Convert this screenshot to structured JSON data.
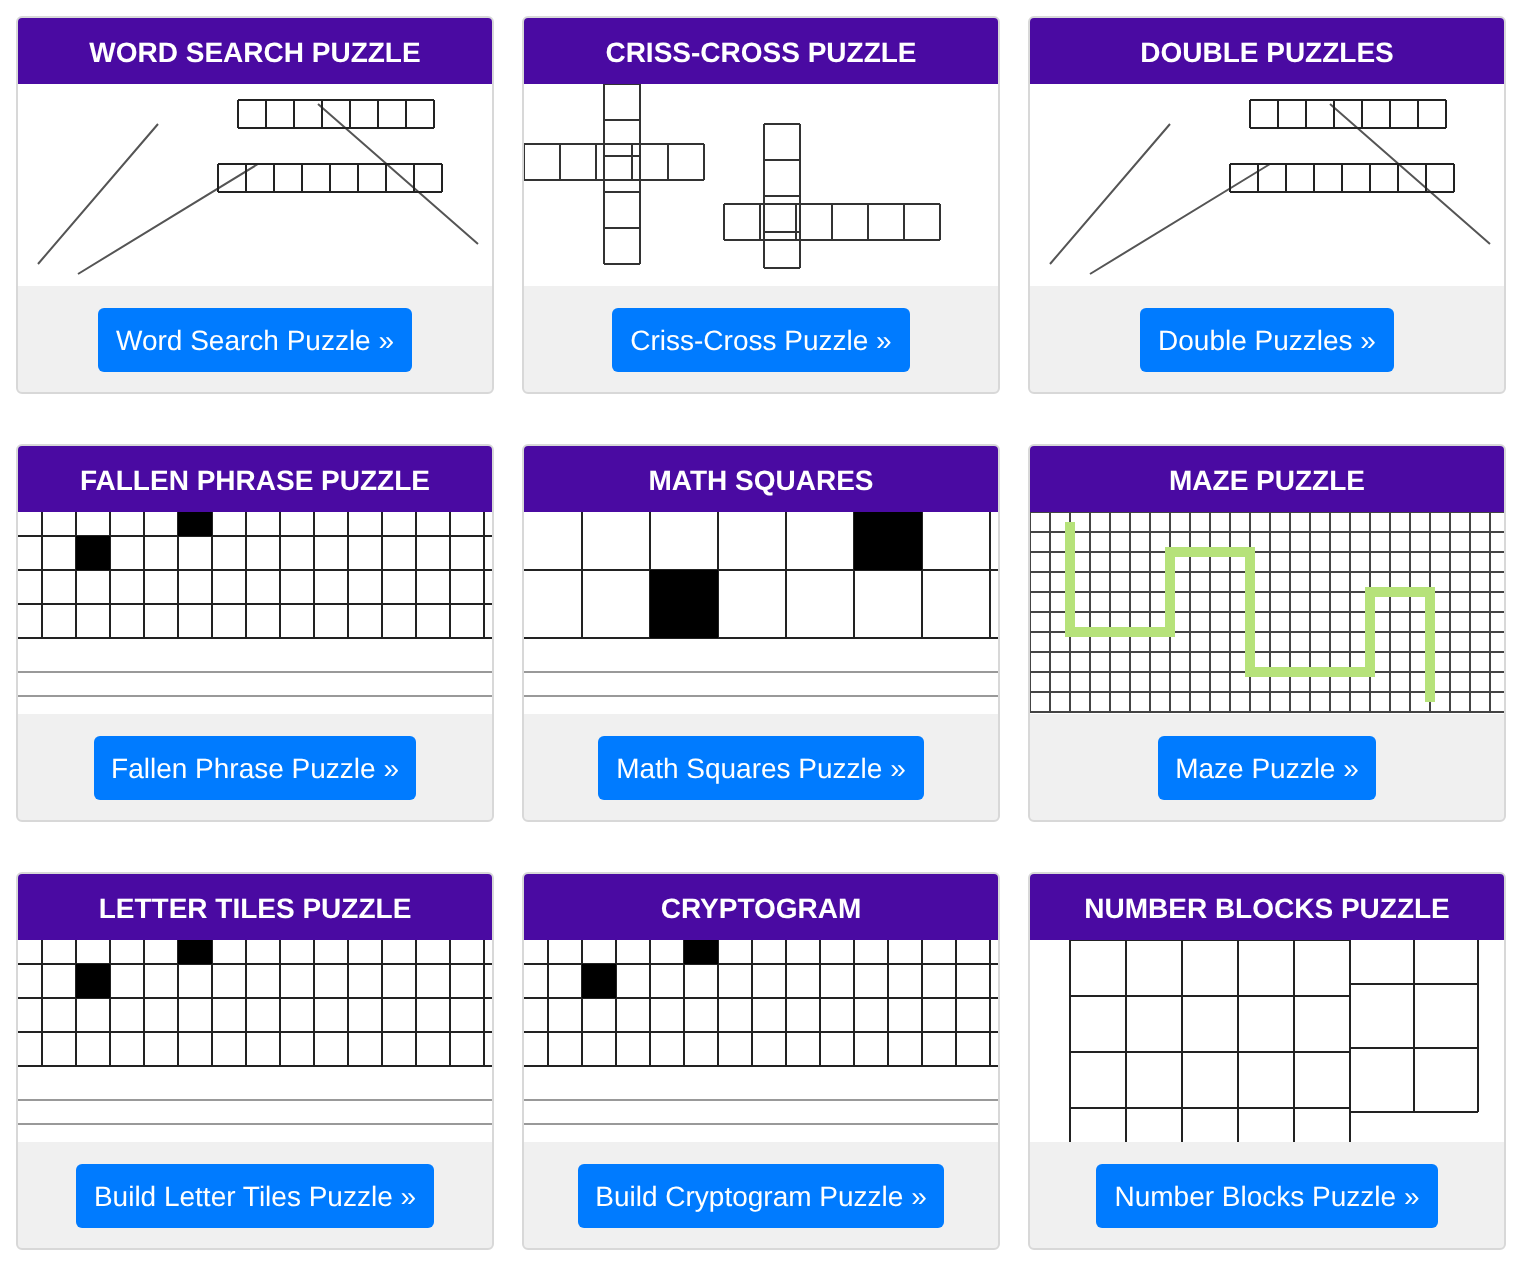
{
  "cards": [
    {
      "title": "WORD SEARCH PUZZLE",
      "button": "Word Search Puzzle »"
    },
    {
      "title": "CRISS-CROSS PUZZLE",
      "button": "Criss-Cross Puzzle »"
    },
    {
      "title": "DOUBLE PUZZLES",
      "button": "Double Puzzles »"
    },
    {
      "title": "FALLEN PHRASE PUZZLE",
      "button": "Fallen Phrase Puzzle »"
    },
    {
      "title": "MATH SQUARES",
      "button": "Math Squares Puzzle »"
    },
    {
      "title": "MAZE PUZZLE",
      "button": "Maze Puzzle »"
    },
    {
      "title": "LETTER TILES PUZZLE",
      "button": "Build Letter Tiles Puzzle »"
    },
    {
      "title": "CRYPTOGRAM",
      "button": "Build Cryptogram Puzzle »"
    },
    {
      "title": "NUMBER BLOCKS PUZZLE",
      "button": "Number Blocks Puzzle »"
    }
  ]
}
